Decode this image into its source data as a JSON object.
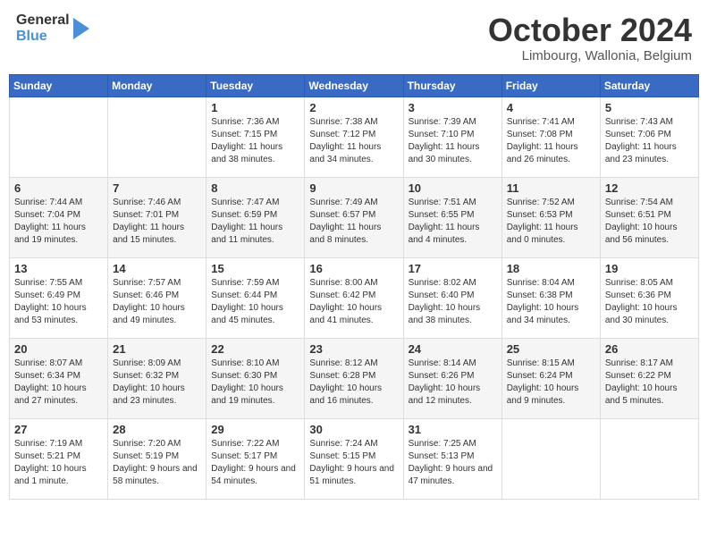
{
  "header": {
    "logo_general": "General",
    "logo_blue": "Blue",
    "month": "October 2024",
    "location": "Limbourg, Wallonia, Belgium"
  },
  "weekdays": [
    "Sunday",
    "Monday",
    "Tuesday",
    "Wednesday",
    "Thursday",
    "Friday",
    "Saturday"
  ],
  "weeks": [
    [
      {
        "day": "",
        "sunrise": "",
        "sunset": "",
        "daylight": ""
      },
      {
        "day": "",
        "sunrise": "",
        "sunset": "",
        "daylight": ""
      },
      {
        "day": "1",
        "sunrise": "Sunrise: 7:36 AM",
        "sunset": "Sunset: 7:15 PM",
        "daylight": "Daylight: 11 hours and 38 minutes."
      },
      {
        "day": "2",
        "sunrise": "Sunrise: 7:38 AM",
        "sunset": "Sunset: 7:12 PM",
        "daylight": "Daylight: 11 hours and 34 minutes."
      },
      {
        "day": "3",
        "sunrise": "Sunrise: 7:39 AM",
        "sunset": "Sunset: 7:10 PM",
        "daylight": "Daylight: 11 hours and 30 minutes."
      },
      {
        "day": "4",
        "sunrise": "Sunrise: 7:41 AM",
        "sunset": "Sunset: 7:08 PM",
        "daylight": "Daylight: 11 hours and 26 minutes."
      },
      {
        "day": "5",
        "sunrise": "Sunrise: 7:43 AM",
        "sunset": "Sunset: 7:06 PM",
        "daylight": "Daylight: 11 hours and 23 minutes."
      }
    ],
    [
      {
        "day": "6",
        "sunrise": "Sunrise: 7:44 AM",
        "sunset": "Sunset: 7:04 PM",
        "daylight": "Daylight: 11 hours and 19 minutes."
      },
      {
        "day": "7",
        "sunrise": "Sunrise: 7:46 AM",
        "sunset": "Sunset: 7:01 PM",
        "daylight": "Daylight: 11 hours and 15 minutes."
      },
      {
        "day": "8",
        "sunrise": "Sunrise: 7:47 AM",
        "sunset": "Sunset: 6:59 PM",
        "daylight": "Daylight: 11 hours and 11 minutes."
      },
      {
        "day": "9",
        "sunrise": "Sunrise: 7:49 AM",
        "sunset": "Sunset: 6:57 PM",
        "daylight": "Daylight: 11 hours and 8 minutes."
      },
      {
        "day": "10",
        "sunrise": "Sunrise: 7:51 AM",
        "sunset": "Sunset: 6:55 PM",
        "daylight": "Daylight: 11 hours and 4 minutes."
      },
      {
        "day": "11",
        "sunrise": "Sunrise: 7:52 AM",
        "sunset": "Sunset: 6:53 PM",
        "daylight": "Daylight: 11 hours and 0 minutes."
      },
      {
        "day": "12",
        "sunrise": "Sunrise: 7:54 AM",
        "sunset": "Sunset: 6:51 PM",
        "daylight": "Daylight: 10 hours and 56 minutes."
      }
    ],
    [
      {
        "day": "13",
        "sunrise": "Sunrise: 7:55 AM",
        "sunset": "Sunset: 6:49 PM",
        "daylight": "Daylight: 10 hours and 53 minutes."
      },
      {
        "day": "14",
        "sunrise": "Sunrise: 7:57 AM",
        "sunset": "Sunset: 6:46 PM",
        "daylight": "Daylight: 10 hours and 49 minutes."
      },
      {
        "day": "15",
        "sunrise": "Sunrise: 7:59 AM",
        "sunset": "Sunset: 6:44 PM",
        "daylight": "Daylight: 10 hours and 45 minutes."
      },
      {
        "day": "16",
        "sunrise": "Sunrise: 8:00 AM",
        "sunset": "Sunset: 6:42 PM",
        "daylight": "Daylight: 10 hours and 41 minutes."
      },
      {
        "day": "17",
        "sunrise": "Sunrise: 8:02 AM",
        "sunset": "Sunset: 6:40 PM",
        "daylight": "Daylight: 10 hours and 38 minutes."
      },
      {
        "day": "18",
        "sunrise": "Sunrise: 8:04 AM",
        "sunset": "Sunset: 6:38 PM",
        "daylight": "Daylight: 10 hours and 34 minutes."
      },
      {
        "day": "19",
        "sunrise": "Sunrise: 8:05 AM",
        "sunset": "Sunset: 6:36 PM",
        "daylight": "Daylight: 10 hours and 30 minutes."
      }
    ],
    [
      {
        "day": "20",
        "sunrise": "Sunrise: 8:07 AM",
        "sunset": "Sunset: 6:34 PM",
        "daylight": "Daylight: 10 hours and 27 minutes."
      },
      {
        "day": "21",
        "sunrise": "Sunrise: 8:09 AM",
        "sunset": "Sunset: 6:32 PM",
        "daylight": "Daylight: 10 hours and 23 minutes."
      },
      {
        "day": "22",
        "sunrise": "Sunrise: 8:10 AM",
        "sunset": "Sunset: 6:30 PM",
        "daylight": "Daylight: 10 hours and 19 minutes."
      },
      {
        "day": "23",
        "sunrise": "Sunrise: 8:12 AM",
        "sunset": "Sunset: 6:28 PM",
        "daylight": "Daylight: 10 hours and 16 minutes."
      },
      {
        "day": "24",
        "sunrise": "Sunrise: 8:14 AM",
        "sunset": "Sunset: 6:26 PM",
        "daylight": "Daylight: 10 hours and 12 minutes."
      },
      {
        "day": "25",
        "sunrise": "Sunrise: 8:15 AM",
        "sunset": "Sunset: 6:24 PM",
        "daylight": "Daylight: 10 hours and 9 minutes."
      },
      {
        "day": "26",
        "sunrise": "Sunrise: 8:17 AM",
        "sunset": "Sunset: 6:22 PM",
        "daylight": "Daylight: 10 hours and 5 minutes."
      }
    ],
    [
      {
        "day": "27",
        "sunrise": "Sunrise: 7:19 AM",
        "sunset": "Sunset: 5:21 PM",
        "daylight": "Daylight: 10 hours and 1 minute."
      },
      {
        "day": "28",
        "sunrise": "Sunrise: 7:20 AM",
        "sunset": "Sunset: 5:19 PM",
        "daylight": "Daylight: 9 hours and 58 minutes."
      },
      {
        "day": "29",
        "sunrise": "Sunrise: 7:22 AM",
        "sunset": "Sunset: 5:17 PM",
        "daylight": "Daylight: 9 hours and 54 minutes."
      },
      {
        "day": "30",
        "sunrise": "Sunrise: 7:24 AM",
        "sunset": "Sunset: 5:15 PM",
        "daylight": "Daylight: 9 hours and 51 minutes."
      },
      {
        "day": "31",
        "sunrise": "Sunrise: 7:25 AM",
        "sunset": "Sunset: 5:13 PM",
        "daylight": "Daylight: 9 hours and 47 minutes."
      },
      {
        "day": "",
        "sunrise": "",
        "sunset": "",
        "daylight": ""
      },
      {
        "day": "",
        "sunrise": "",
        "sunset": "",
        "daylight": ""
      }
    ]
  ]
}
